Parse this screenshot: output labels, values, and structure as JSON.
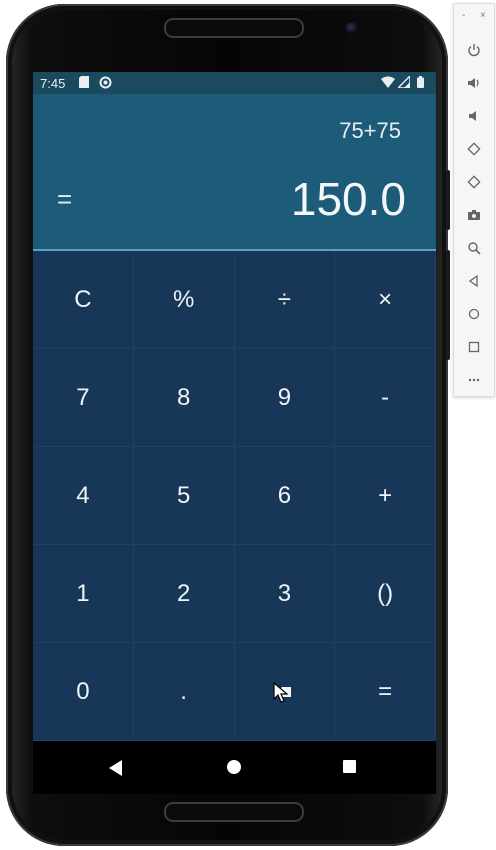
{
  "status_bar": {
    "time": "7:45"
  },
  "calculator": {
    "expression": "75+75",
    "equals_sign": "=",
    "result": "150.0",
    "keys": [
      {
        "label": "C",
        "name": "clear"
      },
      {
        "label": "%",
        "name": "percent"
      },
      {
        "label": "÷",
        "name": "divide"
      },
      {
        "label": "×",
        "name": "multiply"
      },
      {
        "label": "7",
        "name": "digit-7"
      },
      {
        "label": "8",
        "name": "digit-8"
      },
      {
        "label": "9",
        "name": "digit-9"
      },
      {
        "label": "-",
        "name": "subtract"
      },
      {
        "label": "4",
        "name": "digit-4"
      },
      {
        "label": "5",
        "name": "digit-5"
      },
      {
        "label": "6",
        "name": "digit-6"
      },
      {
        "label": "+",
        "name": "add"
      },
      {
        "label": "1",
        "name": "digit-1"
      },
      {
        "label": "2",
        "name": "digit-2"
      },
      {
        "label": "3",
        "name": "digit-3"
      },
      {
        "label": "()",
        "name": "parentheses"
      },
      {
        "label": "0",
        "name": "digit-0"
      },
      {
        "label": ".",
        "name": "decimal"
      },
      {
        "label": "",
        "name": "backspace"
      },
      {
        "label": "=",
        "name": "equals"
      }
    ]
  },
  "emulator_toolbar": {
    "window_controls": [
      "-",
      "×"
    ],
    "tools": [
      {
        "icon": "power-icon"
      },
      {
        "icon": "volume-up-icon"
      },
      {
        "icon": "volume-down-icon"
      },
      {
        "icon": "rotate-left-icon"
      },
      {
        "icon": "rotate-right-icon"
      },
      {
        "icon": "camera-icon"
      },
      {
        "icon": "zoom-icon"
      },
      {
        "icon": "back-icon"
      },
      {
        "icon": "home-icon"
      },
      {
        "icon": "overview-icon"
      },
      {
        "icon": "more-icon"
      }
    ]
  },
  "colors": {
    "display_bg": "#1d5c78",
    "status_bar_bg": "#1a4a5e",
    "keypad_bg": "#173658",
    "divider": "#5aa1c4"
  }
}
